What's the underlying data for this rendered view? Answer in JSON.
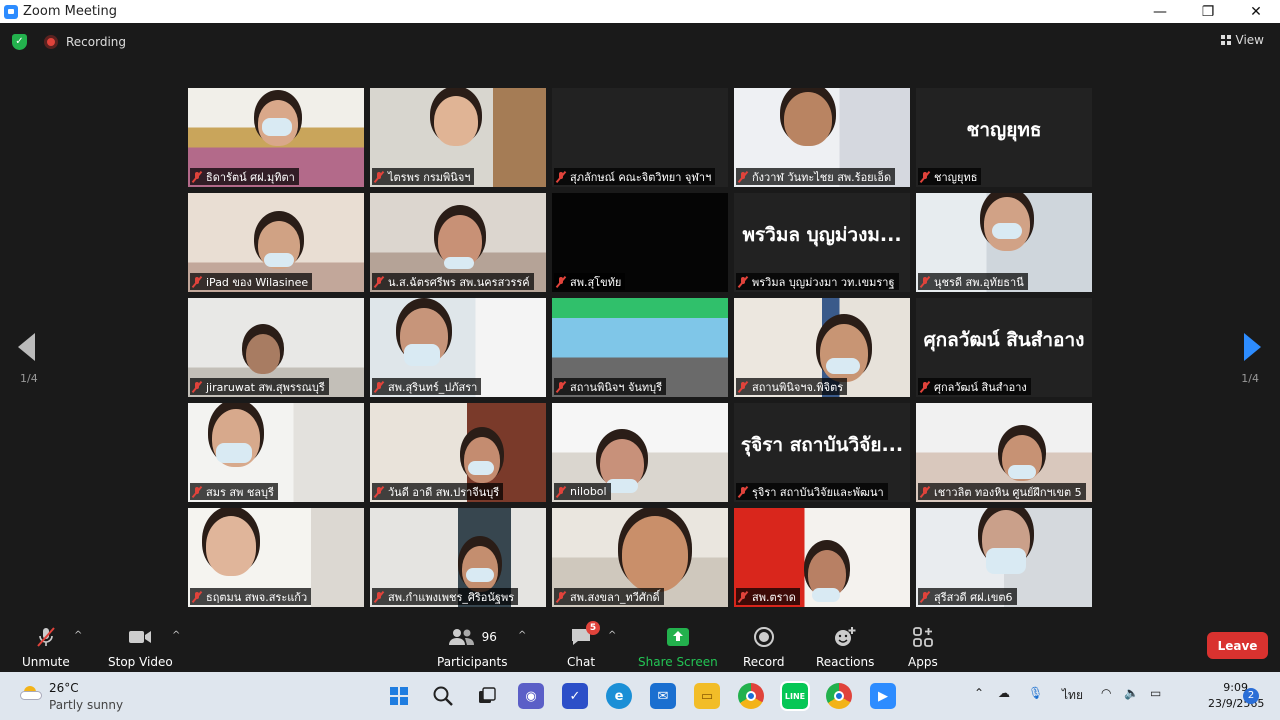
{
  "window": {
    "title": "Zoom Meeting",
    "minimize": "—",
    "maximize": "❐",
    "close": "✕"
  },
  "topbar": {
    "recording_label": "Recording",
    "view_label": "View"
  },
  "pagination": {
    "left": "1/4",
    "right": "1/4"
  },
  "participants": [
    {
      "name": "ธิดารัตน์ ศฝ.มุทิตา",
      "big": ""
    },
    {
      "name": "ไตรพร กรมพินิจฯ",
      "big": ""
    },
    {
      "name": "สุภลักษณ์ คณะจิตวิทยา จุฬาฯ",
      "big": ""
    },
    {
      "name": "กังวาฬ วันทะไชย สพ.ร้อยเอ็ด",
      "big": ""
    },
    {
      "name": "ชาญยุทธ",
      "big": "ชาญยุทธ"
    },
    {
      "name": "iPad ของ Wilasinee",
      "big": ""
    },
    {
      "name": "น.ส.ฉัตรศรีพร สพ.นครสวรรค์",
      "big": ""
    },
    {
      "name": "สพ.สุโขทัย",
      "big": ""
    },
    {
      "name": "พรวิมล  บุญม่วงมา วท.เขมราฐ",
      "big": "พรวิมล  บุญม่วงม..."
    },
    {
      "name": "นุชรดี สพ.อุทัยธานี",
      "big": ""
    },
    {
      "name": "jiraruwat สพ.สุพรรณบุรี",
      "big": ""
    },
    {
      "name": "สพ.สุรินทร์_ปภัสรา",
      "big": ""
    },
    {
      "name": "สถานพินิจฯ จันทบุรี",
      "big": ""
    },
    {
      "name": "สถานพินิจฯจ.พิจิตร",
      "big": ""
    },
    {
      "name": "ศุกลวัฒน์ สินสำอาง",
      "big": "ศุกลวัฒน์ สินสำอาง"
    },
    {
      "name": "สมร สพ ชลบุรี",
      "big": ""
    },
    {
      "name": "วันดี อาดี สพ.ปราจีนบุรี",
      "big": ""
    },
    {
      "name": "nilobol",
      "big": ""
    },
    {
      "name": "รุจิรา สถาบันวิจัยและพัฒนา",
      "big": "รุจิรา สถาบันวิจัย..."
    },
    {
      "name": "เชาวลิต ทองหิน ศูนย์ฝึกฯเขต 5",
      "big": ""
    },
    {
      "name": "ธฤตมน สพจ.สระแก้ว",
      "big": ""
    },
    {
      "name": "สพ.กำแพงเพชร_ศิริอนัฐพร",
      "big": ""
    },
    {
      "name": "สพ.สงขลา_ทวีศักดิ์",
      "big": ""
    },
    {
      "name": "สพ.ตราด",
      "big": ""
    },
    {
      "name": "สุรีสวดี ศฝ.เขต6",
      "big": ""
    }
  ],
  "toolbar": {
    "unmute": "Unmute",
    "stop_video": "Stop Video",
    "participants": "Participants",
    "participants_count": "96",
    "chat": "Chat",
    "chat_badge": "5",
    "share_screen": "Share Screen",
    "record": "Record",
    "reactions": "Reactions",
    "apps": "Apps",
    "leave": "Leave"
  },
  "taskbar": {
    "temperature": "26°C",
    "condition": "Partly sunny",
    "language": "ไทย",
    "time": "9:09",
    "date": "23/9/2565",
    "notifications": "2"
  },
  "colors": {
    "accent": "#2d8cff",
    "active_speaker": "#c6e05a",
    "leave": "#d9322f",
    "share": "#23b14d"
  }
}
